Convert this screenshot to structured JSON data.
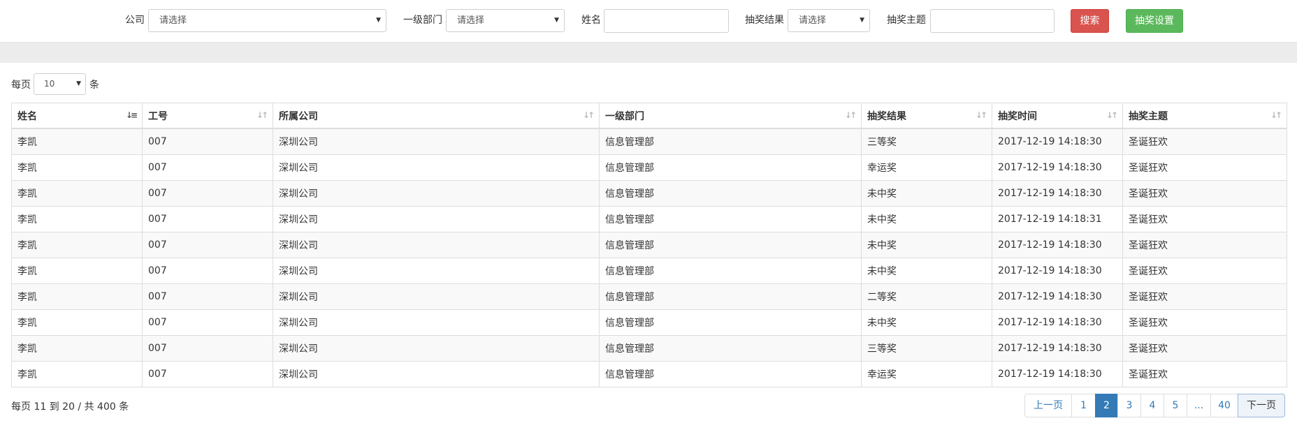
{
  "filters": {
    "company_label": "公司",
    "company_value": "请选择",
    "dept_label": "一级部门",
    "dept_value": "请选择",
    "name_label": "姓名",
    "name_value": "",
    "result_label": "抽奖结果",
    "result_value": "请选择",
    "theme_label": "抽奖主题",
    "theme_value": "",
    "search_button": "搜索",
    "settings_button": "抽奖设置"
  },
  "page_size": {
    "prefix": "每页",
    "value": "10",
    "suffix": "条"
  },
  "table": {
    "columns": [
      "姓名",
      "工号",
      "所属公司",
      "一级部门",
      "抽奖结果",
      "抽奖时间",
      "抽奖主题"
    ],
    "rows": [
      [
        "李凯",
        "007",
        "深圳公司",
        "信息管理部",
        "三等奖",
        "2017-12-19 14:18:30",
        "圣诞狂欢"
      ],
      [
        "李凯",
        "007",
        "深圳公司",
        "信息管理部",
        "幸运奖",
        "2017-12-19 14:18:30",
        "圣诞狂欢"
      ],
      [
        "李凯",
        "007",
        "深圳公司",
        "信息管理部",
        "未中奖",
        "2017-12-19 14:18:30",
        "圣诞狂欢"
      ],
      [
        "李凯",
        "007",
        "深圳公司",
        "信息管理部",
        "未中奖",
        "2017-12-19 14:18:31",
        "圣诞狂欢"
      ],
      [
        "李凯",
        "007",
        "深圳公司",
        "信息管理部",
        "未中奖",
        "2017-12-19 14:18:30",
        "圣诞狂欢"
      ],
      [
        "李凯",
        "007",
        "深圳公司",
        "信息管理部",
        "未中奖",
        "2017-12-19 14:18:30",
        "圣诞狂欢"
      ],
      [
        "李凯",
        "007",
        "深圳公司",
        "信息管理部",
        "二等奖",
        "2017-12-19 14:18:30",
        "圣诞狂欢"
      ],
      [
        "李凯",
        "007",
        "深圳公司",
        "信息管理部",
        "未中奖",
        "2017-12-19 14:18:30",
        "圣诞狂欢"
      ],
      [
        "李凯",
        "007",
        "深圳公司",
        "信息管理部",
        "三等奖",
        "2017-12-19 14:18:30",
        "圣诞狂欢"
      ],
      [
        "李凯",
        "007",
        "深圳公司",
        "信息管理部",
        "幸运奖",
        "2017-12-19 14:18:30",
        "圣诞狂欢"
      ]
    ]
  },
  "footer": {
    "summary": "每页 11 到 20 / 共 400 条"
  },
  "pagination": {
    "items": [
      "上一页",
      "1",
      "2",
      "3",
      "4",
      "5",
      "...",
      "40",
      "下一页"
    ],
    "active": "2"
  },
  "colors": {
    "search_button": "#d9534f",
    "settings_button": "#5cb85c",
    "pagination_active": "#337ab7",
    "link": "#337ab7"
  }
}
